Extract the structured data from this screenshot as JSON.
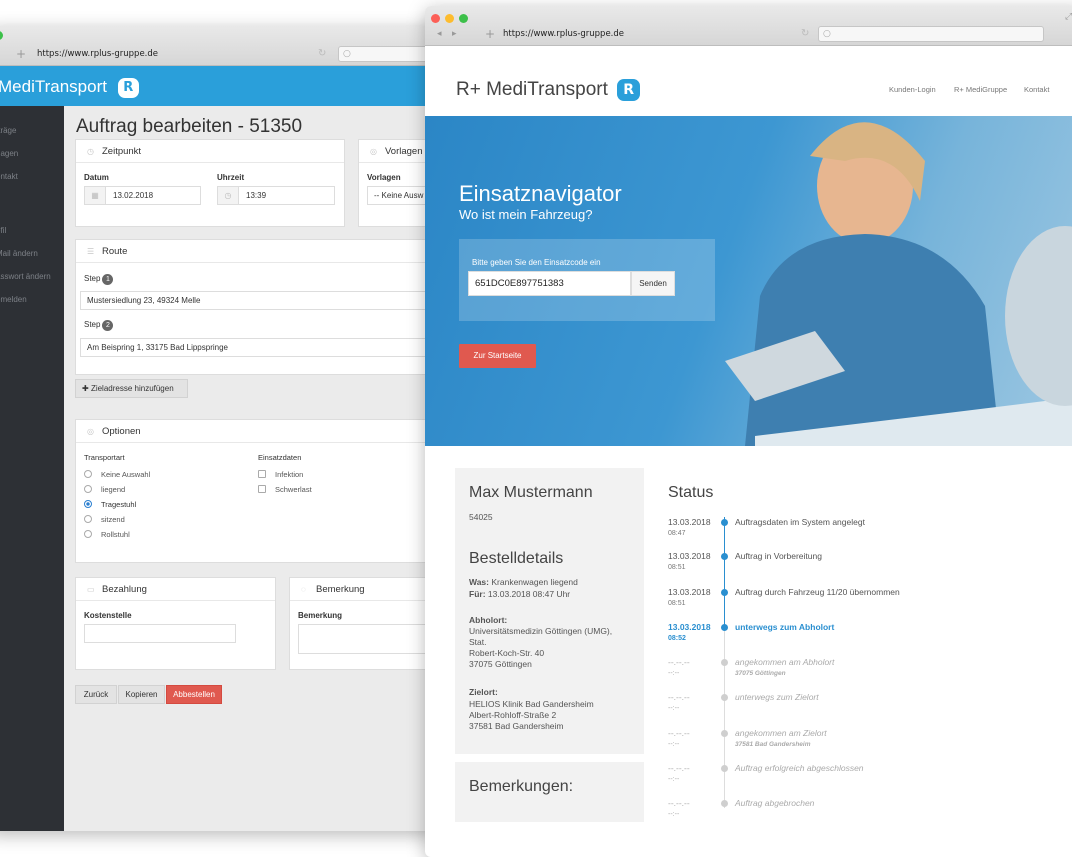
{
  "admin": {
    "url": "https://www.rplus-gruppe.de",
    "brand": "MediTransport",
    "logo_letter": "R",
    "sidebar": [
      "fträge",
      "rlagen",
      "ontakt",
      "ofil",
      "Mail ändern",
      "asswort ändern",
      "bmelden"
    ],
    "title": "Auftrag bearbeiten - 51350",
    "zeitpunkt": {
      "header": "Zeitpunkt",
      "datum_label": "Datum",
      "datum_value": "13.02.2018",
      "uhrzeit_label": "Uhrzeit",
      "uhrzeit_value": "13:39"
    },
    "vorlagen": {
      "header": "Vorlagen",
      "label": "Vorlagen",
      "value": "-- Keine Ausw"
    },
    "route": {
      "header": "Route",
      "step_label": "Step",
      "step1_num": "1",
      "step1_value": "Mustersiedlung 23, 49324 Melle",
      "step2_num": "2",
      "step2_value": "Am Beispring 1, 33175 Bad Lippspringe",
      "add_button": "Zieladresse hinzufügen"
    },
    "optionen": {
      "header": "Optionen",
      "transportart_label": "Transportart",
      "transportart": [
        "Keine Auswahl",
        "liegend",
        "Tragestuhl",
        "sitzend",
        "Rollstuhl"
      ],
      "selected": "Tragestuhl",
      "einsatzdaten_label": "Einsatzdaten",
      "einsatzdaten": [
        "Infektion",
        "Schwerlast"
      ]
    },
    "bezahlung": {
      "header": "Bezahlung",
      "label": "Kostenstelle"
    },
    "bemerkung": {
      "header": "Bemerkung",
      "label": "Bemerkung"
    },
    "buttons": {
      "back": "Zurück",
      "copy": "Kopieren",
      "cancel": "Abbestellen"
    },
    "colors": {
      "brand": "#2a9fda",
      "danger": "#e0594f",
      "sidebar": "#2d3035"
    }
  },
  "public": {
    "url": "https://www.rplus-gruppe.de",
    "brand": "R+ MediTransport",
    "logo_letter": "R",
    "nav": [
      "Kunden-Login",
      "R+ MediGruppe",
      "Kontakt"
    ],
    "hero": {
      "title": "Einsatznavigator",
      "subtitle": "Wo ist mein Fahrzeug?",
      "prompt": "Bitte geben Sie den Einsatzcode ein",
      "code": "651DC0E897751383",
      "send": "Senden",
      "start": "Zur Startseite"
    },
    "customer": {
      "name": "Max Mustermann",
      "id": "54025",
      "details_title": "Bestelldetails",
      "was_label": "Was:",
      "was_value": "Krankenwagen liegend",
      "fuer_label": "Für:",
      "fuer_value": "13.03.2018 08:47 Uhr",
      "abholort_label": "Abholort:",
      "abholort": [
        "Universitätsmedizin Göttingen (UMG),",
        "Stat.",
        "Robert-Koch-Str. 40",
        "37075 Göttingen"
      ],
      "zielort_label": "Zielort:",
      "zielort": [
        "HELIOS Klinik Bad Gandersheim",
        "Albert-Rohloff-Straße 2",
        "37581 Bad Gandersheim"
      ],
      "remarks_title": "Bemerkungen:"
    },
    "status": {
      "title": "Status",
      "entries": [
        {
          "date": "13.03.2018",
          "time": "08:47",
          "text": "Auftragsdaten im System angelegt",
          "state": "done"
        },
        {
          "date": "13.03.2018",
          "time": "08:51",
          "text": "Auftrag in Vorbereitung",
          "state": "done"
        },
        {
          "date": "13.03.2018",
          "time": "08:51",
          "text": "Auftrag durch Fahrzeug 11/20 übernommen",
          "state": "done"
        },
        {
          "date": "13.03.2018",
          "time": "08:52",
          "text": "unterwegs zum Abholort",
          "state": "current"
        },
        {
          "date": "--.--.--",
          "time": "--:--",
          "text": "angekommen am Abholort",
          "sub": "37075 Göttingen",
          "state": "pending"
        },
        {
          "date": "--.--.--",
          "time": "--:--",
          "text": "unterwegs zum Zielort",
          "state": "pending"
        },
        {
          "date": "--.--.--",
          "time": "--:--",
          "text": "angekommen am Zielort",
          "sub": "37581 Bad Gandersheim",
          "state": "pending"
        },
        {
          "date": "--.--.--",
          "time": "--:--",
          "text": "Auftrag erfolgreich abgeschlossen",
          "state": "pending"
        },
        {
          "date": "--.--.--",
          "time": "--:--",
          "text": "Auftrag abgebrochen",
          "state": "pending"
        }
      ]
    },
    "colors": {
      "accent": "#2a8fd0",
      "button": "#e0594f"
    }
  }
}
